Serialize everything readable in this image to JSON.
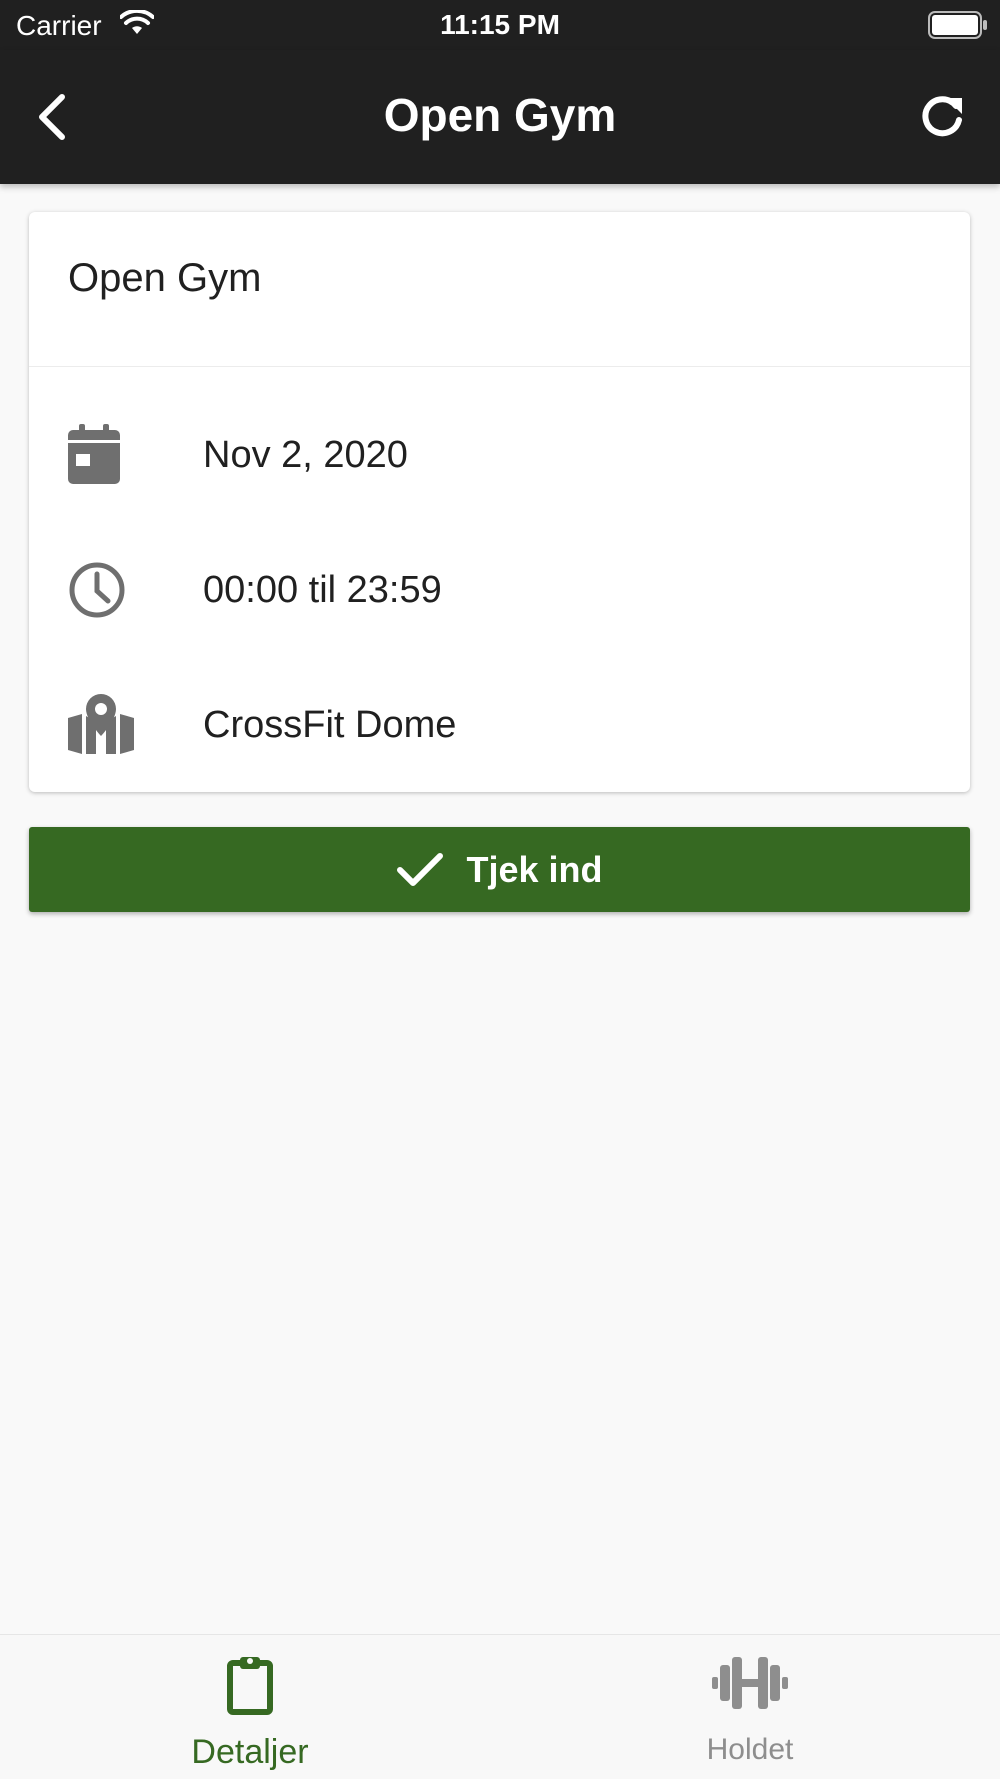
{
  "status_bar": {
    "carrier": "Carrier",
    "time": "11:15 PM"
  },
  "nav": {
    "title": "Open Gym",
    "back_icon": "chevron-left-icon",
    "refresh_icon": "refresh-icon"
  },
  "event": {
    "title": "Open Gym",
    "date": "Nov 2, 2020",
    "time_range": "00:00 til 23:59",
    "location": "CrossFit Dome"
  },
  "checkin_button": {
    "label": "Tjek ind"
  },
  "tabs": [
    {
      "label": "Detaljer",
      "icon": "clipboard-icon",
      "active": true
    },
    {
      "label": "Holdet",
      "icon": "dumbbell-icon",
      "active": false
    }
  ],
  "colors": {
    "accent": "#366922",
    "header": "#202020",
    "icon_gray": "#6f6f6f",
    "inactive": "#8e8e8e"
  }
}
